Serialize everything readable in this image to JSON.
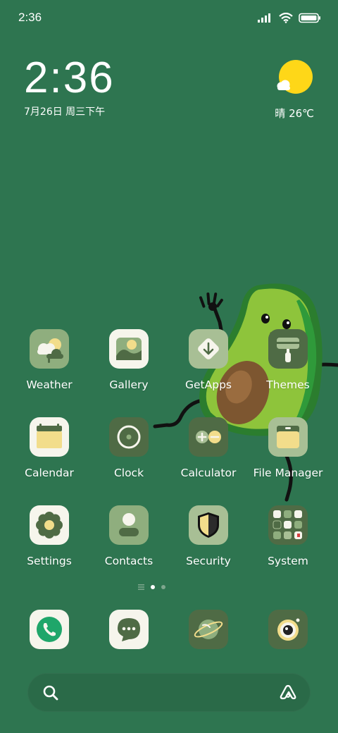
{
  "status_bar": {
    "time": "2:36"
  },
  "clock_widget": {
    "time": "2:36",
    "date": "7月26日 周三下午"
  },
  "weather_widget": {
    "text": "晴 26℃"
  },
  "apps": [
    {
      "id": "weather",
      "label": "Weather"
    },
    {
      "id": "gallery",
      "label": "Gallery"
    },
    {
      "id": "getapps",
      "label": "GetApps"
    },
    {
      "id": "themes",
      "label": "Themes"
    },
    {
      "id": "calendar",
      "label": "Calendar"
    },
    {
      "id": "clock",
      "label": "Clock"
    },
    {
      "id": "calculator",
      "label": "Calculator"
    },
    {
      "id": "file-manager",
      "label": "File Manager"
    },
    {
      "id": "settings",
      "label": "Settings"
    },
    {
      "id": "contacts",
      "label": "Contacts"
    },
    {
      "id": "security",
      "label": "Security"
    },
    {
      "id": "system",
      "label": "System"
    }
  ],
  "dock": [
    {
      "id": "phone",
      "icon": "phone-icon"
    },
    {
      "id": "messages",
      "icon": "message-icon"
    },
    {
      "id": "browser",
      "icon": "planet-icon"
    },
    {
      "id": "camera",
      "icon": "camera-icon"
    }
  ],
  "pager": {
    "pages": 2,
    "active": 1
  },
  "colors": {
    "background": "#2e7550",
    "icon_sage": "#8fae7e",
    "icon_dark": "#4f6b45",
    "icon_cream": "#f6f5ec",
    "accent_yellow": "#f2dd8b",
    "sun": "#fed718"
  }
}
